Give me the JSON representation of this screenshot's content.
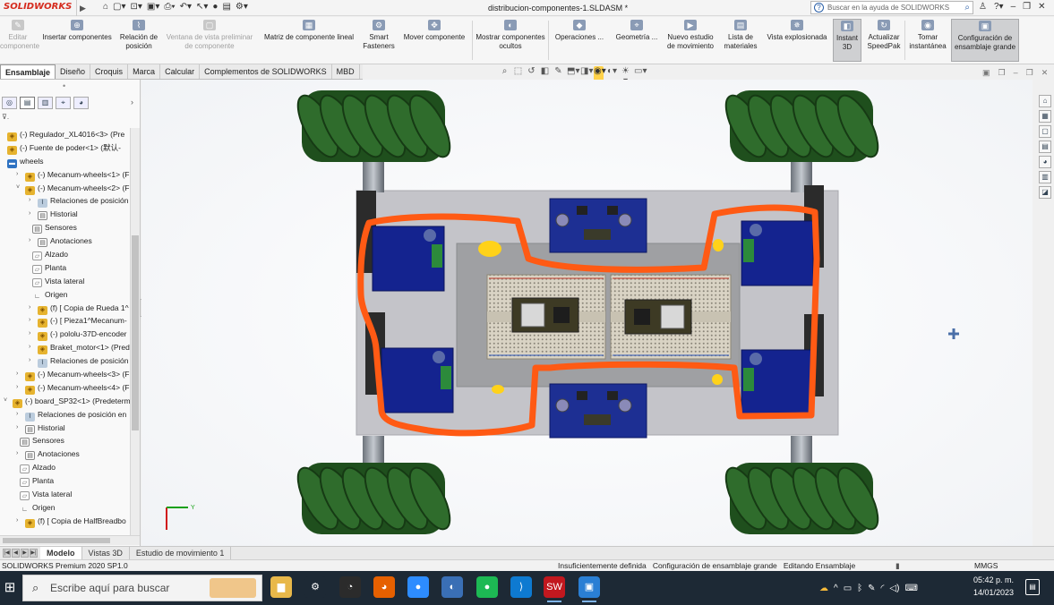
{
  "app": {
    "name": "SOLIDWORKS",
    "document_title": "distribucion-componentes-1.SLDASM *"
  },
  "help_search": {
    "placeholder": "Buscar en la ayuda de SOLIDWORKS"
  },
  "command_manager": [
    {
      "label": "Editar componente",
      "state": "disabled"
    },
    {
      "label": "Insertar componentes",
      "state": "normal"
    },
    {
      "label": "Relación de posición",
      "state": "normal"
    },
    {
      "label": "Ventana de vista preliminar de componente",
      "state": "disabled"
    },
    {
      "label": "Matriz de componente lineal",
      "state": "normal"
    },
    {
      "label": "Smart Fasteners",
      "state": "normal"
    },
    {
      "label": "Mover componente",
      "state": "normal"
    },
    {
      "label": "Mostrar componentes ocultos",
      "state": "normal"
    },
    {
      "label": "Operaciones ...",
      "state": "normal"
    },
    {
      "label": "Geometría ...",
      "state": "normal"
    },
    {
      "label": "Nuevo estudio de movimiento",
      "state": "normal"
    },
    {
      "label": "Lista de materiales",
      "state": "normal"
    },
    {
      "label": "Vista explosionada",
      "state": "normal"
    },
    {
      "label": "Instant 3D",
      "state": "active"
    },
    {
      "label": "Actualizar SpeedPak",
      "state": "normal"
    },
    {
      "label": "Tomar instantánea",
      "state": "normal"
    },
    {
      "label": "Configuración de ensamblaje grande",
      "state": "active"
    }
  ],
  "tabs": [
    "Ensamblaje",
    "Diseño",
    "Croquis",
    "Marca",
    "Calcular",
    "Complementos de SOLIDWORKS",
    "MBD"
  ],
  "active_tab": "Ensamblaje",
  "feature_tree": [
    {
      "label": "(-) Regulador_XL4016<3> (Pre",
      "icon": "assembly",
      "indent": 0,
      "expander": ""
    },
    {
      "label": "(-) Fuente de poder<1> (默认-",
      "icon": "assembly",
      "indent": 0,
      "expander": ""
    },
    {
      "label": "wheels",
      "icon": "folder",
      "indent": 0,
      "expander": ""
    },
    {
      "label": "(-) Mecanum-wheels<1> (F",
      "icon": "assembly",
      "indent": 1,
      "expander": "›"
    },
    {
      "label": "(-) Mecanum-wheels<2> (F",
      "icon": "assembly",
      "indent": 1,
      "expander": "˅"
    },
    {
      "label": "Relaciones de posición",
      "icon": "mate",
      "indent": 2,
      "expander": "›"
    },
    {
      "label": "Historial",
      "icon": "doc",
      "indent": 2,
      "expander": "›"
    },
    {
      "label": "Sensores",
      "icon": "doc",
      "indent": 2,
      "expander": ""
    },
    {
      "label": "Anotaciones",
      "icon": "doc",
      "indent": 2,
      "expander": "›"
    },
    {
      "label": "Alzado",
      "icon": "plane",
      "indent": 2,
      "expander": ""
    },
    {
      "label": "Planta",
      "icon": "plane",
      "indent": 2,
      "expander": ""
    },
    {
      "label": "Vista lateral",
      "icon": "plane",
      "indent": 2,
      "expander": ""
    },
    {
      "label": "Origen",
      "icon": "origin",
      "indent": 2,
      "expander": ""
    },
    {
      "label": "(f) [ Copia de Rueda 1^",
      "icon": "assembly",
      "indent": 2,
      "expander": "›"
    },
    {
      "label": "(-) [ Pieza1^Mecanum-",
      "icon": "assembly",
      "indent": 2,
      "expander": "›"
    },
    {
      "label": "(-) pololu-37D-encoder",
      "icon": "assembly",
      "indent": 2,
      "expander": "›"
    },
    {
      "label": "Braket_motor<1> (Pred",
      "icon": "assembly",
      "indent": 2,
      "expander": "›"
    },
    {
      "label": "Relaciones de posición",
      "icon": "mate",
      "indent": 2,
      "expander": "›"
    },
    {
      "label": "(-) Mecanum-wheels<3> (F",
      "icon": "assembly",
      "indent": 1,
      "expander": "›"
    },
    {
      "label": "(-) Mecanum-wheels<4> (F",
      "icon": "assembly",
      "indent": 1,
      "expander": "›"
    },
    {
      "label": "(-) board_SP32<1> (Predeterm",
      "icon": "assembly",
      "indent": 0,
      "expander": "˅"
    },
    {
      "label": "Relaciones de posición en",
      "icon": "mate",
      "indent": 1,
      "expander": "›"
    },
    {
      "label": "Historial",
      "icon": "doc",
      "indent": 1,
      "expander": "›"
    },
    {
      "label": "Sensores",
      "icon": "doc",
      "indent": 1,
      "expander": ""
    },
    {
      "label": "Anotaciones",
      "icon": "doc",
      "indent": 1,
      "expander": "›"
    },
    {
      "label": "Alzado",
      "icon": "plane",
      "indent": 1,
      "expander": ""
    },
    {
      "label": "Planta",
      "icon": "plane",
      "indent": 1,
      "expander": ""
    },
    {
      "label": "Vista lateral",
      "icon": "plane",
      "indent": 1,
      "expander": ""
    },
    {
      "label": "Origen",
      "icon": "origin",
      "indent": 1,
      "expander": ""
    },
    {
      "label": "(f) [ Copia de HalfBreadbo",
      "icon": "assembly",
      "indent": 1,
      "expander": "›"
    }
  ],
  "bottom_tabs": [
    "Modelo",
    "Vistas 3D",
    "Estudio de movimiento 1"
  ],
  "active_bottom_tab": "Modelo",
  "status_bar": {
    "left": "SOLIDWORKS Premium 2020 SP1.0",
    "state": "Insuficientemente definida",
    "config": "Configuración de ensamblaje grande",
    "mode": "Editando Ensamblaje",
    "units": "MMGS"
  },
  "taskbar": {
    "search_placeholder": "Escribe aquí para buscar",
    "time": "05:42 p. m.",
    "date": "14/01/2023",
    "apps": [
      "file-explorer-icon",
      "settings-icon",
      "app-icon",
      "firefox-icon",
      "zoom-icon",
      "paint-icon",
      "spotify-icon",
      "vscode-icon",
      "solidworks-icon",
      "photos-icon"
    ]
  },
  "colors": {
    "annotation_stroke": "#ff5a14",
    "annotation_dots": "#ffd21a",
    "wheel_green": "#2d6a2a",
    "motor_blue": "#14238f",
    "chassis_gray": "#c2c2c8",
    "solidworks_red": "#d52b1e"
  }
}
